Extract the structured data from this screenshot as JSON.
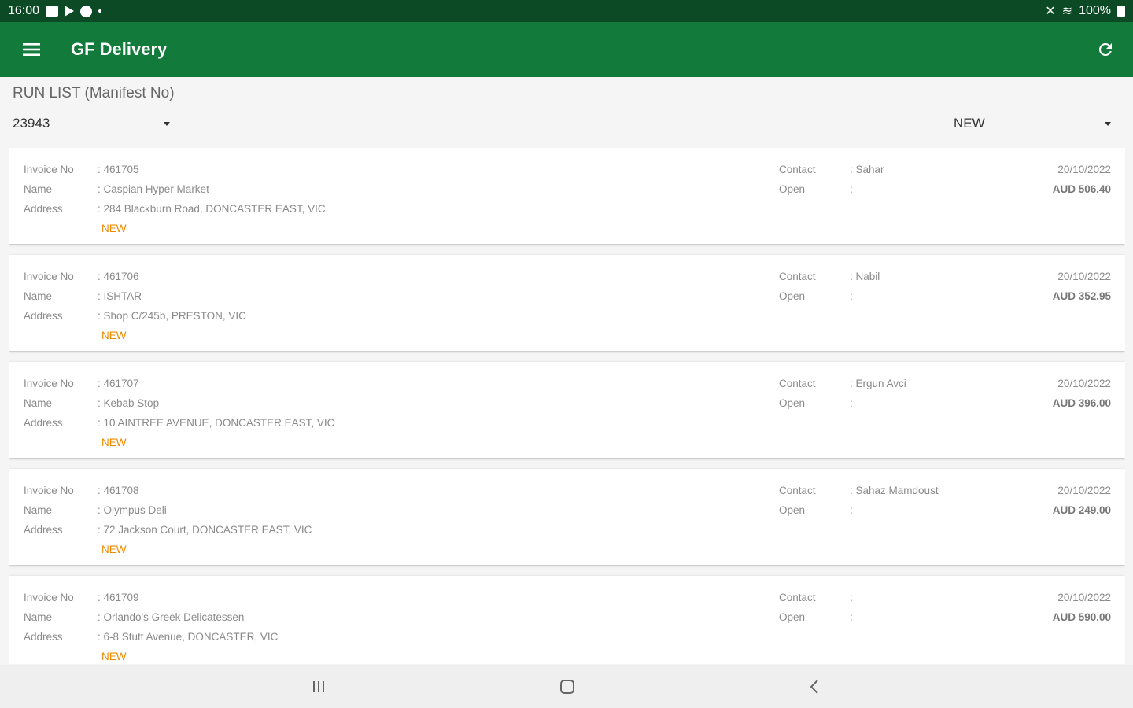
{
  "status_bar": {
    "time": "16:00",
    "battery": "100%"
  },
  "app_bar": {
    "title": "GF Delivery"
  },
  "filters": {
    "header": "RUN LIST (Manifest No)",
    "manifest_value": "23943",
    "status_value": "NEW"
  },
  "labels": {
    "invoice": "Invoice No",
    "name": "Name",
    "address": "Address",
    "contact": "Contact",
    "open": "Open"
  },
  "colors": {
    "status_bar": "#0b4a24",
    "app_bar": "#127b3b",
    "badge": "#f08a00"
  },
  "deliveries": [
    {
      "invoice": "461705",
      "name": "Caspian Hyper Market",
      "address": "284 Blackburn Road, DONCASTER EAST, VIC",
      "status": "NEW",
      "contact": "Sahar",
      "open": "",
      "date": "20/10/2022",
      "amount": "AUD 506.40"
    },
    {
      "invoice": "461706",
      "name": "ISHTAR",
      "address": "Shop C/245b, PRESTON, VIC",
      "status": "NEW",
      "contact": "Nabil",
      "open": "",
      "date": "20/10/2022",
      "amount": "AUD 352.95"
    },
    {
      "invoice": "461707",
      "name": "Kebab Stop",
      "address": "10 AINTREE AVENUE, DONCASTER EAST, VIC",
      "status": "NEW",
      "contact": "Ergun Avci",
      "open": "",
      "date": "20/10/2022",
      "amount": "AUD 396.00"
    },
    {
      "invoice": "461708",
      "name": "Olympus Deli",
      "address": "72 Jackson Court, DONCASTER EAST, VIC",
      "status": "NEW",
      "contact": "Sahaz Mamdoust",
      "open": "",
      "date": "20/10/2022",
      "amount": "AUD 249.00"
    },
    {
      "invoice": "461709",
      "name": "Orlando's Greek Delicatessen",
      "address": "6-8 Stutt Avenue, DONCASTER, VIC",
      "status": "NEW",
      "contact": "",
      "open": "",
      "date": "20/10/2022",
      "amount": "AUD 590.00"
    }
  ]
}
